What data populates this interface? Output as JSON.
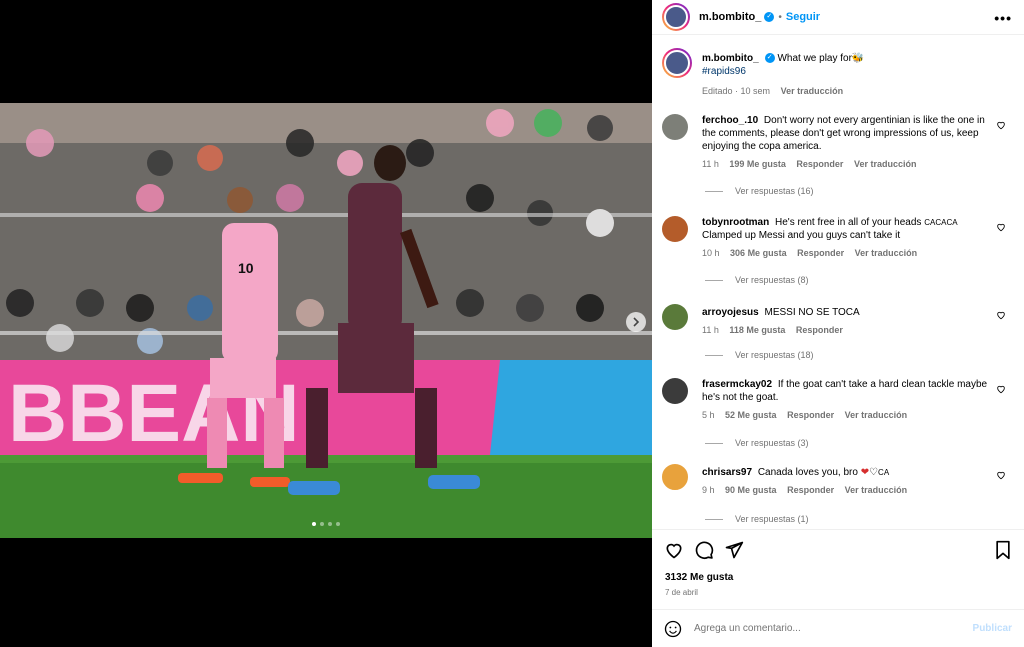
{
  "post": {
    "author": "m.bombito_",
    "follow_label": "Seguir",
    "more_label": "•••",
    "caption": "What we play for🐝",
    "hashtag": "#rapids96",
    "edited": "Editado · 10 sem",
    "see_translation": "Ver traducción"
  },
  "comments": [
    {
      "user": "ferchoo_.10",
      "text": "Don't worry not every argentinian is like the one in the comments, please don't get wrong impressions of us, keep enjoying the copa america.",
      "time": "11 h",
      "likes": "199 Me gusta",
      "reply": "Responder",
      "translate": "Ver traducción",
      "replies": "Ver respuestas (16)",
      "avatar_color": "#7d7f78"
    },
    {
      "user": "tobynrootman",
      "text": "He's rent free in all of your heads",
      "text_suffix": "CACACA",
      "text2": "Clamped up Messi and you guys can't take it",
      "time": "10 h",
      "likes": "306 Me gusta",
      "reply": "Responder",
      "translate": "Ver traducción",
      "replies": "Ver respuestas (8)",
      "avatar_color": "#b45c2a"
    },
    {
      "user": "arroyojesus",
      "text": "MESSI NO SE TOCA",
      "time": "11 h",
      "likes": "118 Me gusta",
      "reply": "Responder",
      "replies": "Ver respuestas (18)",
      "avatar_color": "#5a7a3a"
    },
    {
      "user": "frasermckay02",
      "text": "If the goat can't take a hard clean tackle maybe he's not the goat.",
      "time": "5 h",
      "likes": "52 Me gusta",
      "reply": "Responder",
      "translate": "Ver traducción",
      "replies": "Ver respuestas (3)",
      "avatar_color": "#3b3b3b"
    },
    {
      "user": "chrisars97",
      "text": "Canada loves you, bro",
      "text_suffix": "CA",
      "time": "9 h",
      "likes": "90 Me gusta",
      "reply": "Responder",
      "translate": "Ver traducción",
      "replies": "Ver respuestas (1)",
      "avatar_color": "#e8a23c"
    }
  ],
  "footer": {
    "likes": "3132 Me gusta",
    "date": "7 de abril",
    "comment_placeholder": "Agrega un comentario...",
    "publish": "Publicar"
  },
  "photo": {
    "jersey_number": "10",
    "banner_text": "BBEAN"
  },
  "icons": [
    "heart-icon",
    "comment-icon",
    "share-icon",
    "bookmark-icon",
    "emoji-icon",
    "chevron-right-icon",
    "verified-icon",
    "more-icon"
  ],
  "colors": {
    "accent": "#0095f6",
    "muted": "#737373",
    "banner_pink": "#e8489a",
    "banner_blue": "#2fa6e0",
    "pitch_green": "#3f8a2e"
  }
}
